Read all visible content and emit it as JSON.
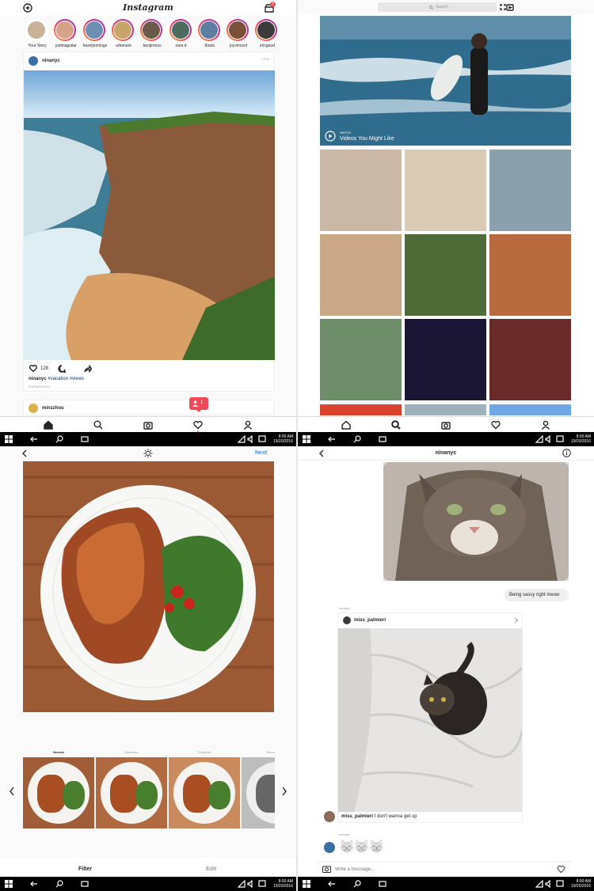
{
  "feed": {
    "app_title": "Instagram",
    "inbox_badge": "2",
    "stories": [
      {
        "name": "Your Story",
        "color": "#c7b29a"
      },
      {
        "name": "justinaguilar",
        "color": "#d8a189"
      },
      {
        "name": "hazeljennings",
        "color": "#6d8fb3"
      },
      {
        "name": "urbanant",
        "color": "#c9a56b"
      },
      {
        "name": "benjirenzo",
        "color": "#6b5a4c"
      },
      {
        "name": "sara.d",
        "color": "#4d6b5f"
      },
      {
        "name": "tboda",
        "color": "#5d7ea0"
      },
      {
        "name": "joyvincent",
        "color": "#7a4f3a"
      },
      {
        "name": "ericgoud",
        "color": "#3b3b3b"
      }
    ],
    "post": {
      "username": "ninanyc",
      "likes": "128",
      "caption_user": "ninanyc",
      "caption_tags": "#vacation #views",
      "time": "8 HOURS AGO"
    },
    "next_post_username": "minzzhou",
    "activity_count": "1"
  },
  "explore": {
    "search_placeholder": "Search",
    "video_label_small": "WATCH",
    "video_label": "Videos You Might Like",
    "grid_colors": [
      "#c9b8a5",
      "#d9cbb6",
      "#8aa0ac",
      "#c9a886",
      "#4f6b3a",
      "#b86a3f",
      "#6f8d6b",
      "#1b1633",
      "#6b2a2a"
    ]
  },
  "editor": {
    "next_label": "Next",
    "filters": [
      "Normal",
      "Clarendon",
      "Gingham",
      "Moon"
    ],
    "tab_filter": "Filter",
    "tab_edit": "Edit"
  },
  "dm": {
    "title": "ninanyc",
    "outgoing_message": "Being sassy right meow",
    "sender_small": "ninanyc",
    "shared_user": "miss_palmieri",
    "caption_user": "miss_palmieri",
    "caption_text": "I don't wanna get up",
    "reply_small": "ninanyc",
    "emoji_reply": "😸😸😸",
    "input_placeholder": "Write a message..."
  },
  "taskbar": {
    "time": "8:00 AM",
    "date": "19/20/2016"
  },
  "colors": {
    "accent_blue": "#3897f0",
    "activity_red": "#ed4956",
    "taskbar_bg": "#000000"
  }
}
